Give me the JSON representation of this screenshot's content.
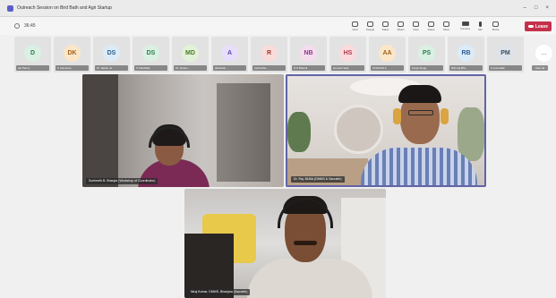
{
  "window": {
    "title": "Outreach Session on Bird Bath and Agri Startup"
  },
  "toolbar": {
    "timer": "36:45",
    "tools": [
      {
        "label": "Chat",
        "icon": "chat-icon"
      },
      {
        "label": "People",
        "icon": "people-icon"
      },
      {
        "label": "Raise",
        "icon": "raise-hand-icon"
      },
      {
        "label": "React",
        "icon": "react-icon"
      },
      {
        "label": "View",
        "icon": "view-icon"
      },
      {
        "label": "Notes",
        "icon": "notes-icon"
      },
      {
        "label": "More",
        "icon": "more-icon"
      }
    ],
    "camera_label": "Camera",
    "mic_label": "Mic",
    "share_label": "Share",
    "leave_label": "Leave"
  },
  "participants": [
    {
      "initials": "D",
      "name": "adi Pamry",
      "bg": "#d9f0e3",
      "fg": "#2e7d4f"
    },
    {
      "initials": "DK",
      "name": "K Lab Enqu",
      "bg": "#fbe6c8",
      "fg": "#a0601a"
    },
    {
      "initials": "DS",
      "name": "Dr. Satish Ja",
      "bg": "#dcebf8",
      "fg": "#2d5f8f"
    },
    {
      "initials": "DS",
      "name": "S Shedbalk",
      "bg": "#d9f0e3",
      "fg": "#2e7d4f"
    },
    {
      "initials": "MD",
      "name": "Mr. Daniel ...",
      "bg": "#e2f2d7",
      "fg": "#4a7a2a"
    },
    {
      "initials": "A",
      "name": "abhishek ...",
      "bg": "#e6defa",
      "fg": "#5b46a8"
    },
    {
      "initials": "R",
      "name": "rashmitha ...",
      "bg": "#f7dcd9",
      "fg": "#9a3a32"
    },
    {
      "initials": "NB",
      "name": "N S Bhandi",
      "bg": "#f4dcef",
      "fg": "#8f3a80"
    },
    {
      "initials": "HS",
      "name": "Hemant Sapt",
      "bg": "#fadadd",
      "fg": "#b03a4a"
    },
    {
      "initials": "AA",
      "name": "AVINASH A",
      "bg": "#fbe6c8",
      "fg": "#a0601a"
    },
    {
      "initials": "PS",
      "name": "Pooja Singa",
      "bg": "#d9f0e3",
      "fg": "#2e7d4f"
    },
    {
      "initials": "RB",
      "name": "Bhimraj Bhu",
      "bg": "#dcebf8",
      "fg": "#2d5f8f"
    },
    {
      "initials": "PM",
      "name": "P eramHalli",
      "bg": "#dde3ea",
      "fg": "#3e4f63"
    }
  ],
  "more": {
    "label": "...",
    "caption": "View all"
  },
  "videos": [
    {
      "name": "Sunheeth B. Bhanjar (Workshop of Coordinator)"
    },
    {
      "name": "Dr. Raj. BUBA (DMMS & Saurabh)"
    },
    {
      "name": "Niraj Kumar, DMMS, Bhanjara (Saurabh)"
    }
  ]
}
